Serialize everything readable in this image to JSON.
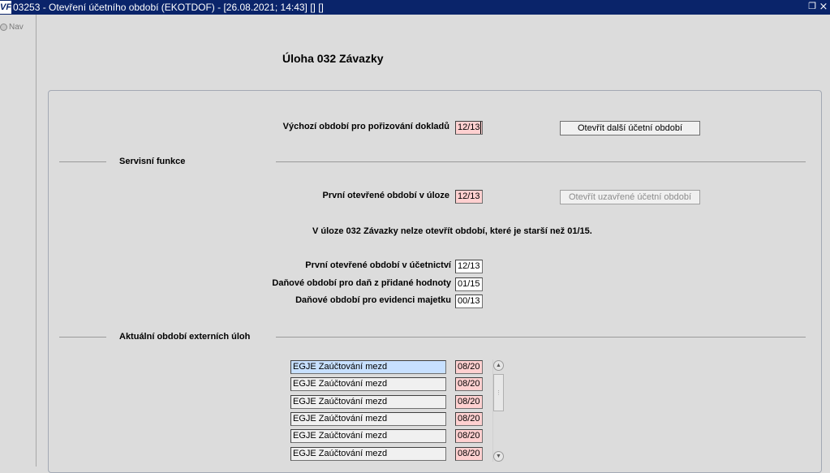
{
  "window": {
    "app_icon": "VF",
    "title": "03253 - Otevření účetního období (EKOTDOF) - [26.08.2021; 14:43]  []  []",
    "restore_icon": "restore-icon",
    "close_icon": "close-icon"
  },
  "nav": {
    "label": "Nav"
  },
  "page": {
    "title": "Úloha  032 Závazky"
  },
  "main": {
    "default_period_label": "Výchozí období pro pořizování dokladů",
    "default_period_value": "12/13",
    "open_next_button": "Otevřít další účetní období"
  },
  "service": {
    "section_title": "Servisní funkce",
    "first_open_label": "První otevřené období v úloze",
    "first_open_value": "12/13",
    "open_closed_button": "Otevřít uzavřené účetní období",
    "info_text": "V úloze 032 Závazky nelze otevřít období, které je starší než 01/15.",
    "accounting_label": "První otevřené období v účetnictví",
    "accounting_value": "12/13",
    "vat_label": "Daňové období pro daň z přidané hodnoty",
    "vat_value": "01/15",
    "asset_label": "Daňové období pro evidenci majetku",
    "asset_value": "00/13"
  },
  "external": {
    "section_title": "Aktuální období externích úloh",
    "rows": [
      {
        "name": "EGJE Zaúčtování mezd",
        "period": "08/20"
      },
      {
        "name": "EGJE Zaúčtování mezd",
        "period": "08/20"
      },
      {
        "name": "EGJE Zaúčtování mezd",
        "period": "08/20"
      },
      {
        "name": "EGJE Zaúčtování mezd",
        "period": "08/20"
      },
      {
        "name": "EGJE Zaúčtování mezd",
        "period": "08/20"
      },
      {
        "name": "EGJE Zaúčtování mezd",
        "period": "08/20"
      }
    ]
  }
}
